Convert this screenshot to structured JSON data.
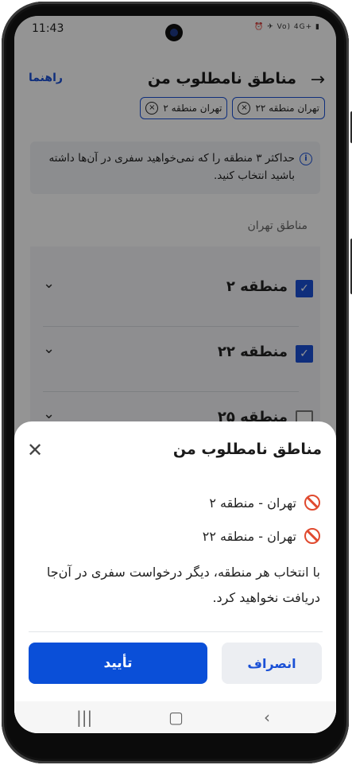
{
  "status": {
    "time": "11:43",
    "icons": "⏰ ✈ Vo) 4G+ ▮"
  },
  "appbar": {
    "title": "مناطق نامطلوب من",
    "guide_label": "راهنما"
  },
  "chips": [
    {
      "label": "تهران منطقه ۲"
    },
    {
      "label": "تهران منطقه ۲۲"
    }
  ],
  "info": {
    "text": "حداکثر ۳ منطقه را که نمی‌خواهید سفری در آن‌ها داشته باشید انتخاب کنید."
  },
  "section_label": "مناطق تهران",
  "list": [
    {
      "label": "منطقه ۲",
      "checked": true
    },
    {
      "label": "منطقه ۲۲",
      "checked": true
    },
    {
      "label": "منطقه ۲۵",
      "checked": false
    }
  ],
  "sheet": {
    "title": "مناطق نامطلوب من",
    "items": [
      {
        "label": "تهران - منطقه ۲"
      },
      {
        "label": "تهران - منطقه ۲۲"
      }
    ],
    "description": "با انتخاب هر منطقه، دیگر درخواست سفری در آن‌جا دریافت نخواهید کرد.",
    "confirm_label": "تأیید",
    "cancel_label": "انصراف"
  },
  "colors": {
    "accent": "#0a4fd8",
    "danger": "#e04a2f"
  }
}
